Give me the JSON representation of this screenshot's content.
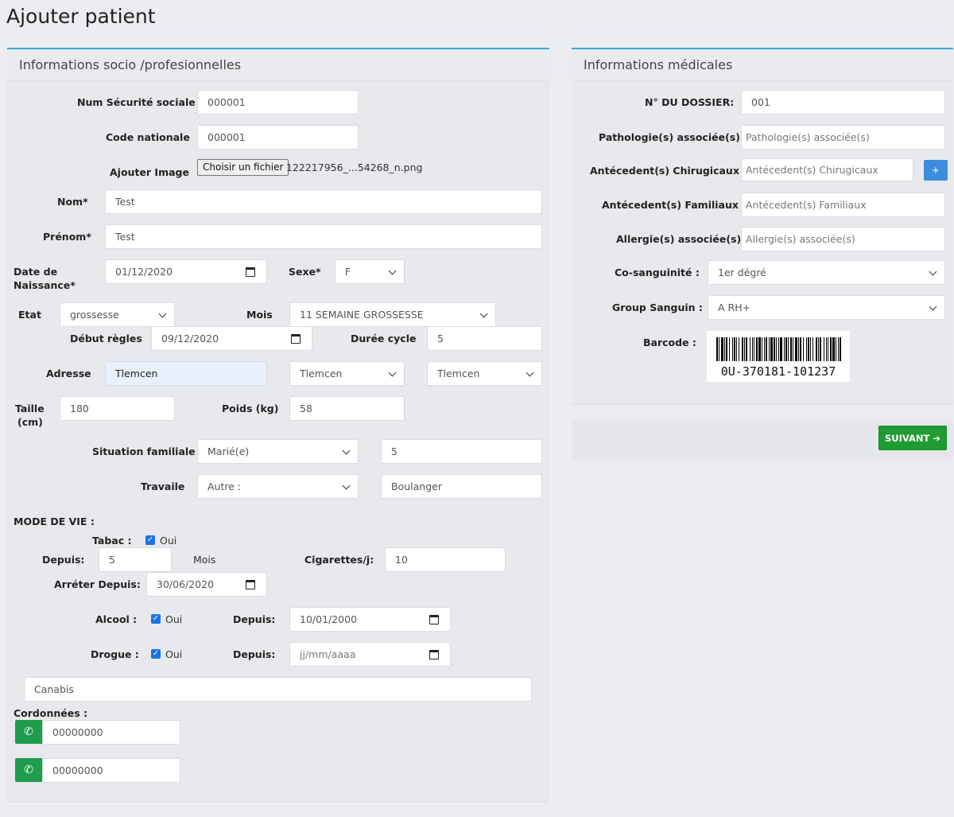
{
  "page": {
    "title": "Ajouter patient"
  },
  "socio": {
    "title": "Informations socio /profesionnelles",
    "num_secu_label": "Num Sécurité sociale",
    "num_secu_value": "000001",
    "code_nat_label": "Code nationale",
    "code_nat_value": "000001",
    "image_label": "Ajouter Image",
    "file_button": "Choisir un fichier",
    "file_name": "122217956_...54268_n.png",
    "nom_label": "Nom*",
    "nom_value": "Test",
    "prenom_label": "Prénom*",
    "prenom_value": "Test",
    "dob_label_1": "Date de",
    "dob_label_2": "Naissance*",
    "dob_value": "01/12/2020",
    "sexe_label": "Sexe*",
    "sexe_value": "F",
    "etat_label": "Etat",
    "etat_value": "grossesse",
    "mois_label": "Mois",
    "mois_value": "11 SEMAINE GROSSESSE",
    "debut_label": "Début règles",
    "debut_value": "09/12/2020",
    "duree_label": "Durée cycle",
    "duree_value": "5",
    "adresse_label": "Adresse",
    "adresse_value": "Tlemcen",
    "wilaya_value": "Tlemcen",
    "commune_value": "Tlemcen",
    "taille_label_1": "Taille",
    "taille_label_2": "(cm)",
    "taille_value": "180",
    "poids_label": "Poids (kg)",
    "poids_value": "58",
    "situation_label": "Situation familiale",
    "situation_value": "Marié(e)",
    "enfants_value": "5",
    "travail_label": "Travaile",
    "travail_value": "Autre :",
    "metier_value": "Boulanger",
    "mode_vie_label": "MODE DE VIE :",
    "tabac_label": "Tabac :",
    "tabac_oui": "Oui",
    "depuis_label": "Depuis:",
    "tabac_depuis_value": "5",
    "mois_unit": "Mois",
    "cigarettes_label": "Cigarettes/j:",
    "cigarettes_value": "10",
    "arreter_label": "Arréter Depuis:",
    "arreter_value": "30/06/2020",
    "alcool_label": "Alcool :",
    "alcool_oui": "Oui",
    "alcool_depuis_label": "Depuis:",
    "alcool_depuis_value": "10/01/2000",
    "drogue_label": "Drogue :",
    "drogue_oui": "Oui",
    "drogue_depuis_label": "Depuis:",
    "drogue_depuis_placeholder": "jj/mm/aaaa",
    "drogue_type_value": "Canabis",
    "coord_label": "Cordonnées :",
    "phone1_value": "00000000",
    "phone2_value": "00000000"
  },
  "medical": {
    "title": "Informations médicales",
    "dossier_label": "N° DU DOSSIER:",
    "dossier_value": "001",
    "pathologie_label": "Pathologie(s) associée(s) :",
    "pathologie_placeholder": "Pathologie(s) associée(s)",
    "chirurgicaux_label": "Antécedent(s) Chirugicaux :",
    "chirurgicaux_placeholder": "Antécedent(s) Chirugicaux",
    "add_button": "+",
    "familiaux_label": "Antécedent(s) Familiaux :",
    "familiaux_placeholder": "Antécedent(s) Familiaux",
    "allergie_label": "Allergie(s) associée(s):",
    "allergie_placeholder": "Allergie(s) associée(s)",
    "consanguinite_label": "Co-sanguinité :",
    "consanguinite_value": "1er dégré",
    "groupe_label": "Group Sanguin :",
    "groupe_value": "A RH+",
    "barcode_label": "Barcode :",
    "barcode_text": "0U-370181-101237"
  },
  "footer": {
    "suivant_label": "SUIVANT"
  },
  "colors": {
    "accent": "#35a8d9",
    "success": "#1f9b33",
    "phone": "#1e9d4c",
    "primary": "#3c8dde"
  }
}
